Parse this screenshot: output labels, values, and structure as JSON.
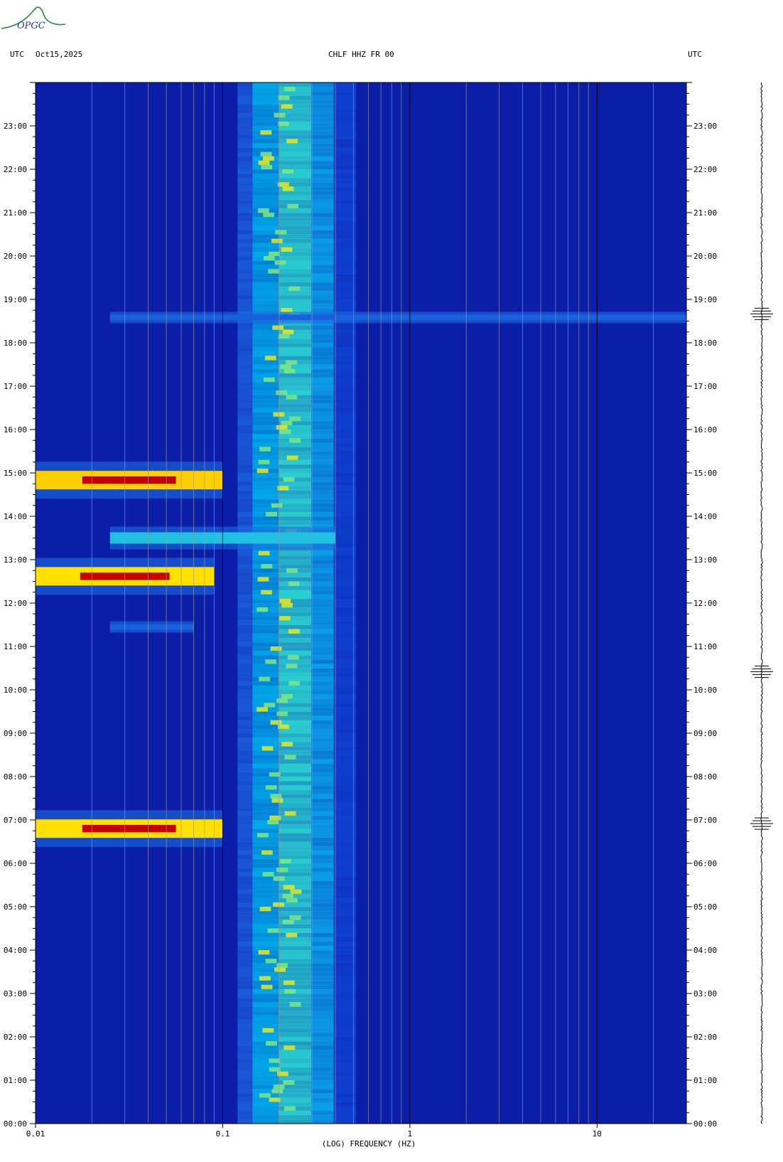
{
  "header": {
    "logo_text": "OPGC",
    "left_tz": "UTC",
    "date": "Oct15,2025",
    "station": "CHLF HHZ FR 00",
    "right_tz": "UTC"
  },
  "colors": {
    "background": "#0a1aa8",
    "low": "#0b1ea8",
    "mid": "#00c8e0",
    "high": "#ffe000",
    "peak": "#c80000",
    "gridline": "#9a9a9a",
    "decade_line": "#000000"
  },
  "chart_data": {
    "type": "heatmap",
    "title": "CHLF HHZ FR 00",
    "xlabel": "(LOG) FREQUENCY (HZ)",
    "ylabel": "UTC",
    "x_scale": "log",
    "xlim": [
      0.01,
      30
    ],
    "ylim_hours": [
      0,
      24
    ],
    "x_ticks": [
      {
        "value": 0.01,
        "label": "0.01"
      },
      {
        "value": 0.1,
        "label": "0.1"
      },
      {
        "value": 1,
        "label": "1"
      },
      {
        "value": 10,
        "label": "10"
      }
    ],
    "y_ticks": [
      "00:00",
      "01:00",
      "02:00",
      "03:00",
      "04:00",
      "05:00",
      "06:00",
      "07:00",
      "08:00",
      "09:00",
      "10:00",
      "11:00",
      "12:00",
      "13:00",
      "14:00",
      "15:00",
      "16:00",
      "17:00",
      "18:00",
      "19:00",
      "20:00",
      "21:00",
      "22:00",
      "23:00"
    ],
    "microseism_band_hz": [
      0.12,
      0.45
    ],
    "microseism_peak_hz": 0.2,
    "events": [
      {
        "time_utc": "06:48",
        "freq_hz": [
          0.01,
          0.1
        ],
        "intensity": "high"
      },
      {
        "time_utc": "11:27",
        "freq_hz": [
          0.025,
          0.07
        ],
        "intensity": "low"
      },
      {
        "time_utc": "12:37",
        "freq_hz": [
          0.01,
          0.09
        ],
        "intensity": "high"
      },
      {
        "time_utc": "13:30",
        "freq_hz": [
          0.025,
          0.4
        ],
        "intensity": "medium"
      },
      {
        "time_utc": "14:50",
        "freq_hz": [
          0.01,
          0.1
        ],
        "intensity": "very high"
      },
      {
        "time_utc": "18:35",
        "freq_hz": [
          0.025,
          30
        ],
        "intensity": "low"
      }
    ],
    "grid": true,
    "legend": "none"
  },
  "seismogram": {
    "events_utc": [
      "06:55",
      "10:25",
      "18:40"
    ]
  },
  "footer_mark": "\""
}
